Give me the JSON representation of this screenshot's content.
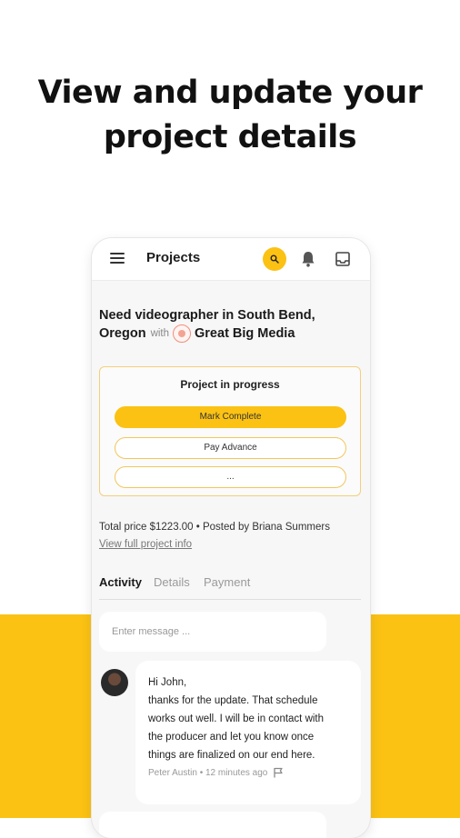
{
  "headline": {
    "line1": "View and update your",
    "line2": "project details"
  },
  "appbar": {
    "title": "Projects",
    "icons": [
      "menu-icon",
      "search-icon",
      "bell-icon",
      "inbox-icon"
    ]
  },
  "project": {
    "title_line1": "Need videographer in South Bend,",
    "title_line2": "Oregon",
    "with_label": "with",
    "company": "Great Big Media"
  },
  "status_card": {
    "title": "Project in progress",
    "primary_action": "Mark Complete",
    "secondary_action": "Pay Advance",
    "more_action": "..."
  },
  "meta": {
    "summary": "Total price $1223.00 • Posted by Briana Summers",
    "link": "View full project info"
  },
  "tabs": [
    {
      "label": "Activity",
      "active": true
    },
    {
      "label": "Details",
      "active": false
    },
    {
      "label": "Payment",
      "active": false
    }
  ],
  "composer": {
    "placeholder": "Enter message ..."
  },
  "messages": [
    {
      "lines": [
        "Hi John,",
        "thanks for the update. That schedule",
        "works out well. I will be in contact with",
        "the producer and let you know once",
        "things are finalized on our end here."
      ],
      "footer": "Peter Austin • 12 minutes ago"
    }
  ],
  "colors": {
    "accent": "#fbc214",
    "card_border": "#f4cf7a",
    "logo": "#f08e7c"
  }
}
